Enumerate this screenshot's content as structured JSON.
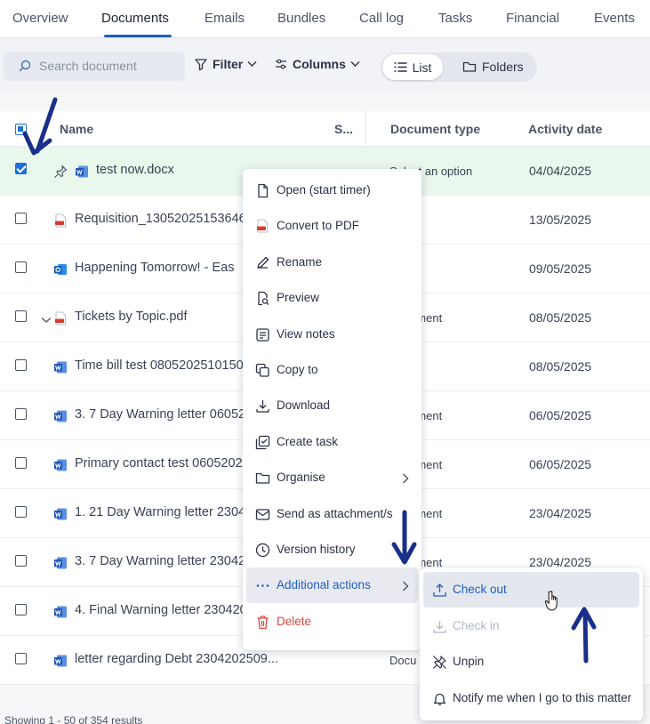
{
  "tabs": [
    "Overview",
    "Documents",
    "Emails",
    "Bundles",
    "Call log",
    "Tasks",
    "Financial",
    "Events"
  ],
  "toolbar": {
    "search_placeholder": "Search document",
    "filter_label": "Filter",
    "columns_label": "Columns",
    "list_label": "List",
    "folders_label": "Folders"
  },
  "table": {
    "headers": {
      "name": "Name",
      "s": "S...",
      "doc_type": "Document type",
      "activity": "Activity date"
    },
    "rows": [
      {
        "name": "test now.docx",
        "type": "Select an option",
        "date": "04/04/2025",
        "checked": true,
        "icon": "word-icon",
        "pinned": true
      },
      {
        "name": "Requisition_13052025153646",
        "type": "",
        "date": "13/05/2025",
        "checked": false,
        "icon": "pdf-icon"
      },
      {
        "name": "Happening Tomorrow! - Eas",
        "type": "",
        "date": "09/05/2025",
        "checked": false,
        "icon": "outlook-icon"
      },
      {
        "name": "Tickets by Topic.pdf",
        "type": "Document",
        "date": "08/05/2025",
        "checked": false,
        "icon": "pdf-icon",
        "expand": true
      },
      {
        "name": "Time bill test 08052025101509",
        "type": "",
        "date": "08/05/2025",
        "checked": false,
        "icon": "word-icon"
      },
      {
        "name": "3. 7 Day Warning letter 06052025",
        "type": "Document",
        "date": "06/05/2025",
        "checked": false,
        "icon": "word-icon"
      },
      {
        "name": "Primary contact test 06052025",
        "type": "Document",
        "date": "06/05/2025",
        "checked": false,
        "icon": "word-icon"
      },
      {
        "name": "1. 21 Day Warning letter 23042025",
        "type": "Document",
        "date": "23/04/2025",
        "checked": false,
        "icon": "word-icon"
      },
      {
        "name": "3. 7 Day Warning letter 23042025",
        "type": "Document",
        "date": "23/04/2025",
        "checked": false,
        "icon": "word-icon"
      },
      {
        "name": "4. Final Warning letter 23042025",
        "type": "",
        "date": "",
        "checked": false,
        "icon": "word-icon"
      },
      {
        "name": "letter regarding Debt 2304202509...",
        "type": "Docu",
        "date": "",
        "checked": false,
        "icon": "word-icon"
      }
    ]
  },
  "footer": "Showing 1 - 50 of 354 results",
  "context_menu": [
    {
      "label": "Open (start timer)",
      "icon": "file-icon"
    },
    {
      "label": "Convert to PDF",
      "icon": "pdf-icon"
    },
    {
      "label": "Rename",
      "icon": "pencil-icon"
    },
    {
      "label": "Preview",
      "icon": "preview-icon"
    },
    {
      "label": "View notes",
      "icon": "notes-icon"
    },
    {
      "label": "Copy to",
      "icon": "copy-icon"
    },
    {
      "label": "Download",
      "icon": "download-icon"
    },
    {
      "label": "Create task",
      "icon": "task-icon"
    },
    {
      "label": "Organise",
      "icon": "folder-icon",
      "submenu": true
    },
    {
      "label": "Send as attachment/s",
      "icon": "mail-icon"
    },
    {
      "label": "Version history",
      "icon": "clock-icon"
    },
    {
      "label": "Additional actions",
      "icon": "more-icon",
      "submenu": true,
      "highlighted": true
    },
    {
      "label": "Delete",
      "icon": "trash-icon",
      "danger": true
    }
  ],
  "submenu": [
    {
      "label": "Check out",
      "icon": "upload-icon",
      "highlighted": true
    },
    {
      "label": "Check in",
      "icon": "download-icon",
      "disabled": true
    },
    {
      "label": "Unpin",
      "icon": "unpin-icon"
    },
    {
      "label": "Notify me when I go to this matter",
      "icon": "bell-icon"
    }
  ],
  "colors": {
    "accent": "#1f5fbf",
    "selected_row": "#e9f7ec",
    "danger": "#e0483e",
    "annotation_arrow": "#1a2f8a"
  }
}
